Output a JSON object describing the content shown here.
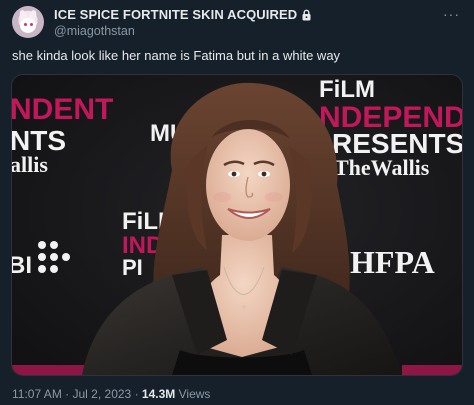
{
  "author": {
    "display_name": "ICE SPICE FORTNITE SKIN ACQUIRED",
    "handle": "@miagothstan",
    "protected_icon": "lock-icon",
    "avatar_icon": "bunny-avatar"
  },
  "menu": {
    "icon": "more-horizontal-icon",
    "label": "···"
  },
  "tweet": {
    "text": "she kinda look like her name is Fatima but in a white way"
  },
  "media": {
    "backdrop_texts": {
      "top_left": [
        "NDENT",
        "NTS",
        "allis"
      ],
      "top_center": "MU",
      "top_right": [
        "FiLM",
        "NDEPENDEN",
        "RESENTS",
        "TheWallis"
      ],
      "mid_left_film": [
        "FiLM",
        "INDE",
        "PI"
      ],
      "mid_left_logo": "BI",
      "right_logo": "HFPA"
    },
    "colors": {
      "backdrop": "#1a1a1d",
      "accent": "#c2185b"
    }
  },
  "meta": {
    "time": "11:07 AM",
    "separator": "·",
    "date": "Jul 2, 2023",
    "views_count": "14.3M",
    "views_label": "Views"
  }
}
